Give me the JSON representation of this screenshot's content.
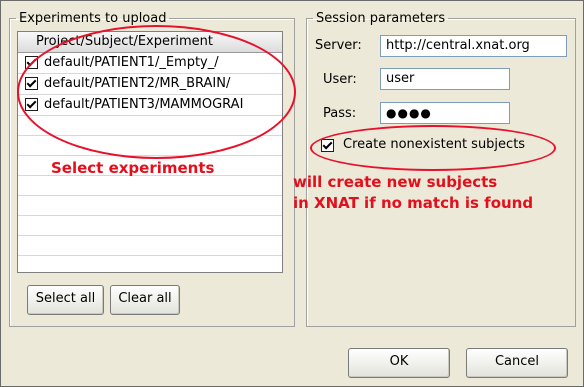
{
  "upload_panel": {
    "legend": "Experiments to upload",
    "column_header": "Project/Subject/Experiment",
    "rows": [
      {
        "label": "default/PATIENT1/_Empty_/",
        "checked": true
      },
      {
        "label": "default/PATIENT2/MR_BRAIN/",
        "checked": true
      },
      {
        "label": "default/PATIENT3/MAMMOGRAI",
        "checked": true
      }
    ],
    "select_all_label": "Select all",
    "clear_all_label": "Clear all"
  },
  "session_panel": {
    "legend": "Session parameters",
    "server_label": "Server:",
    "server_value": "http://central.xnat.org",
    "user_label": "User:",
    "user_value": "user",
    "pass_label": "Pass:",
    "pass_value": "●●●●",
    "create_label": "Create nonexistent subjects",
    "create_checked": true
  },
  "annotations": {
    "select_note": "Select experiments",
    "create_note_line1": "will create new subjects",
    "create_note_line2": "in XNAT if no match is found",
    "highlight_color": "#e30f1c"
  },
  "footer": {
    "ok_label": "OK",
    "cancel_label": "Cancel"
  }
}
